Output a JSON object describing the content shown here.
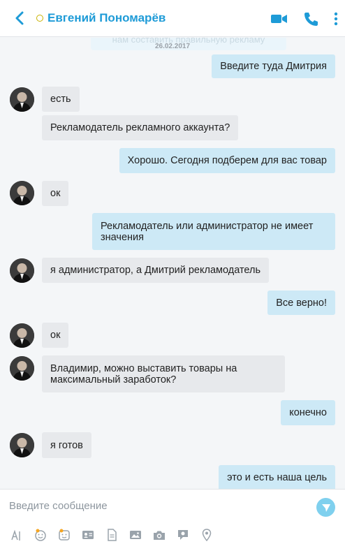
{
  "header": {
    "contact_name": "Евгений Пономарёв"
  },
  "chat": {
    "partial_top_text": "нам составить правильную рекламу",
    "date": "26.02.2017",
    "messages": [
      {
        "dir": "out",
        "text": "Введите туда Дмитрия"
      },
      {
        "dir": "in",
        "text": "есть"
      },
      {
        "dir": "in",
        "text": "Рекламодатель рекламного аккаунта?"
      },
      {
        "dir": "out",
        "text": "Хорошо. Сегодня подберем для вас товар"
      },
      {
        "dir": "in",
        "text": "ок"
      },
      {
        "dir": "out",
        "text": "Рекламодатель или администратор не имеет значения"
      },
      {
        "dir": "in",
        "text": "я администратор, а Дмитрий рекламодатель"
      },
      {
        "dir": "out",
        "text": "Все верно!"
      },
      {
        "dir": "in",
        "text": "ок"
      },
      {
        "dir": "in",
        "text": "Владимир, можно выставить товары на максимальный заработок?"
      },
      {
        "dir": "out",
        "text": "конечно"
      },
      {
        "dir": "in",
        "text": "я готов"
      },
      {
        "dir": "out",
        "text": "это и есть наша цель"
      }
    ]
  },
  "composer": {
    "placeholder": "Введите сообщение"
  },
  "icons": {
    "header": [
      "back-arrow-icon",
      "status-icon",
      "video-call-icon",
      "phone-call-icon",
      "more-icon"
    ],
    "toolbar": [
      "text-format-icon",
      "emoji-icon",
      "mojis-icon",
      "contact-card-icon",
      "file-icon",
      "media-message-icon",
      "camera-icon",
      "video-message-icon",
      "location-icon"
    ],
    "send": "send-icon"
  },
  "colors": {
    "accent": "#1e9bd7",
    "incoming_bubble": "#e7e9ec",
    "outgoing_bubble": "#cde9f6"
  }
}
